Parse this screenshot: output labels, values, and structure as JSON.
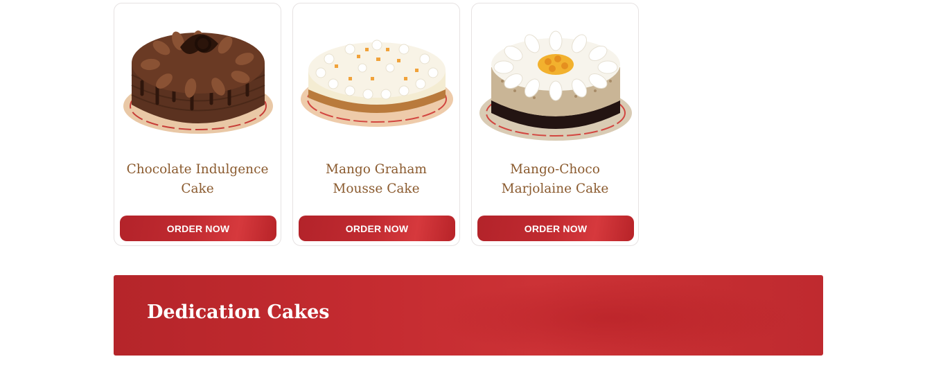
{
  "products": [
    {
      "name": "Chocolate Indulgence Cake",
      "button": "ORDER NOW",
      "image": "chocolate-cake"
    },
    {
      "name": "Mango Graham Mousse Cake",
      "button": "ORDER NOW",
      "image": "mango-mousse-cake"
    },
    {
      "name": "Mango-Choco Marjolaine Cake",
      "button": "ORDER NOW",
      "image": "marjolaine-cake"
    }
  ],
  "section": {
    "title": "Dedication Cakes"
  },
  "colors": {
    "brand_red": "#c02a30",
    "title_brown": "#8a5a2e",
    "card_border": "#e6e2e2"
  }
}
